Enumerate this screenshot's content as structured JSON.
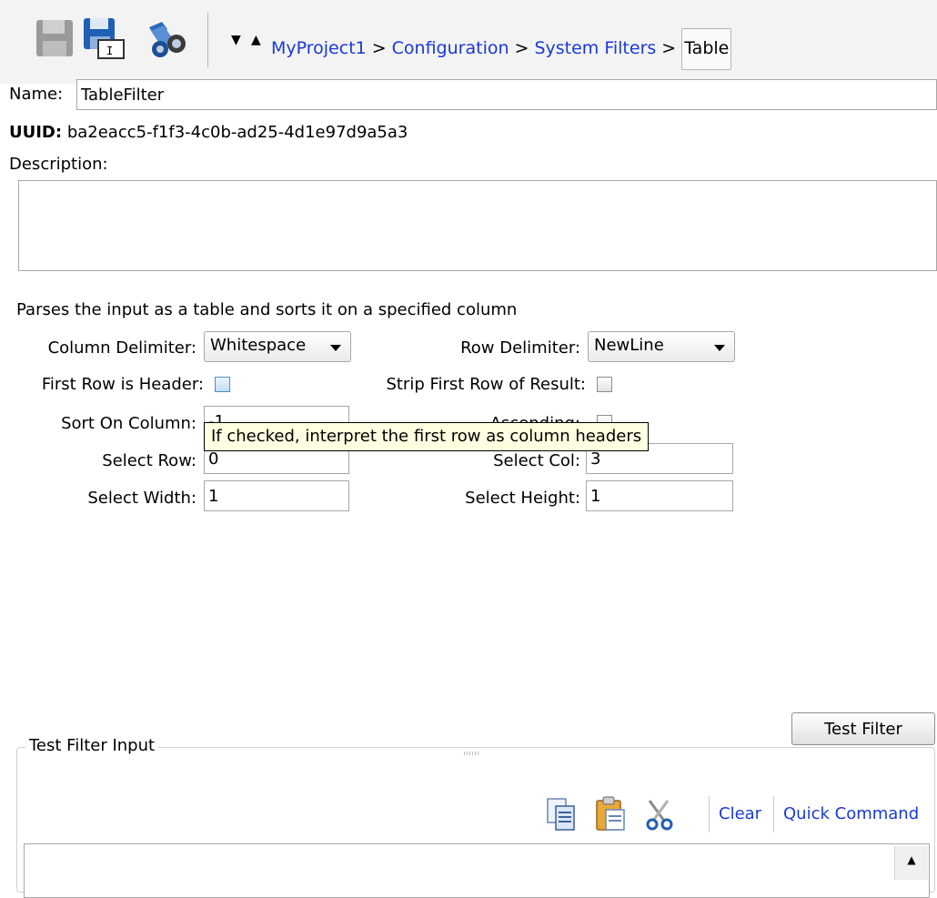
{
  "toolbar": {
    "breadcrumb": [
      "MyProject1",
      "Configuration",
      "System Filters"
    ],
    "separator": ">",
    "current": "Table"
  },
  "form": {
    "name_label": "Name:",
    "name_value": "TableFilter",
    "uuid_label": "UUID:",
    "uuid_value": "ba2eacc5-f1f3-4c0b-ad25-4d1e97d9a5a3",
    "description_label": "Description:",
    "description_value": "",
    "info_text": "Parses the input as a table and sorts it on a specified column",
    "column_delimiter_label": "Column Delimiter:",
    "column_delimiter_value": "Whitespace",
    "row_delimiter_label": "Row Delimiter:",
    "row_delimiter_value": "NewLine",
    "first_row_header_label": "First Row is Header:",
    "strip_first_row_label": "Strip First Row of Result:",
    "sort_on_column_label": "Sort On Column:",
    "sort_on_column_value": "-1",
    "ascending_label": "Ascending:",
    "select_row_label": "Select Row:",
    "select_row_value": "0",
    "select_col_label": "Select Col:",
    "select_col_value": "3",
    "select_width_label": "Select Width:",
    "select_width_value": "1",
    "select_height_label": "Select Height:",
    "select_height_value": "1",
    "tooltip": "If checked, interpret the first row as column headers",
    "test_filter_button": "Test Filter"
  },
  "test_input": {
    "group_title": "Test Filter Input",
    "clear_link": "Clear",
    "quick_command_link": "Quick Command",
    "value": ""
  },
  "colors": {
    "link": "#1a39d8",
    "tooltip_bg": "#ffffe1",
    "toolbar_bg": "#f3f3f3"
  },
  "icons": [
    "save-disabled-icon",
    "save-as-icon",
    "find-binoculars-icon",
    "dropdown-down-icon",
    "dropdown-up-icon",
    "copy-icon",
    "paste-icon",
    "cut-scissors-icon",
    "scroll-up-icon"
  ]
}
